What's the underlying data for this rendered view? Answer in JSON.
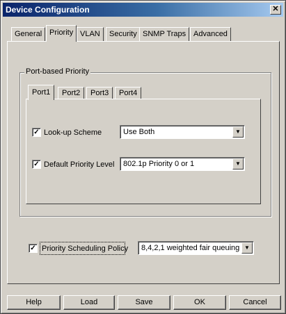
{
  "window": {
    "title": "Device Configuration",
    "close_glyph": "✕"
  },
  "tabs": [
    "General",
    "Priority",
    "VLAN",
    "Security",
    "SNMP Traps",
    "Advanced"
  ],
  "active_tab": "Priority",
  "port_group": {
    "label": "Port-based Priority",
    "subtabs": [
      "Port1",
      "Port2",
      "Port3",
      "Port4"
    ],
    "active_subtab": "Port1",
    "lookup_scheme": {
      "checked": true,
      "label": "Look-up Scheme",
      "value": "Use Both"
    },
    "default_priority": {
      "checked": true,
      "label": "Default Priority Level",
      "value": "802.1p Priority 0 or 1"
    }
  },
  "scheduling": {
    "checked": true,
    "label": "Priority Scheduling Policy",
    "value": "8,4,2,1 weighted fair queuing"
  },
  "buttons": {
    "help": "Help",
    "load": "Load",
    "save": "Save",
    "ok": "OK",
    "cancel": "Cancel"
  },
  "glyphs": {
    "check": "✓",
    "arrow": "▼"
  }
}
